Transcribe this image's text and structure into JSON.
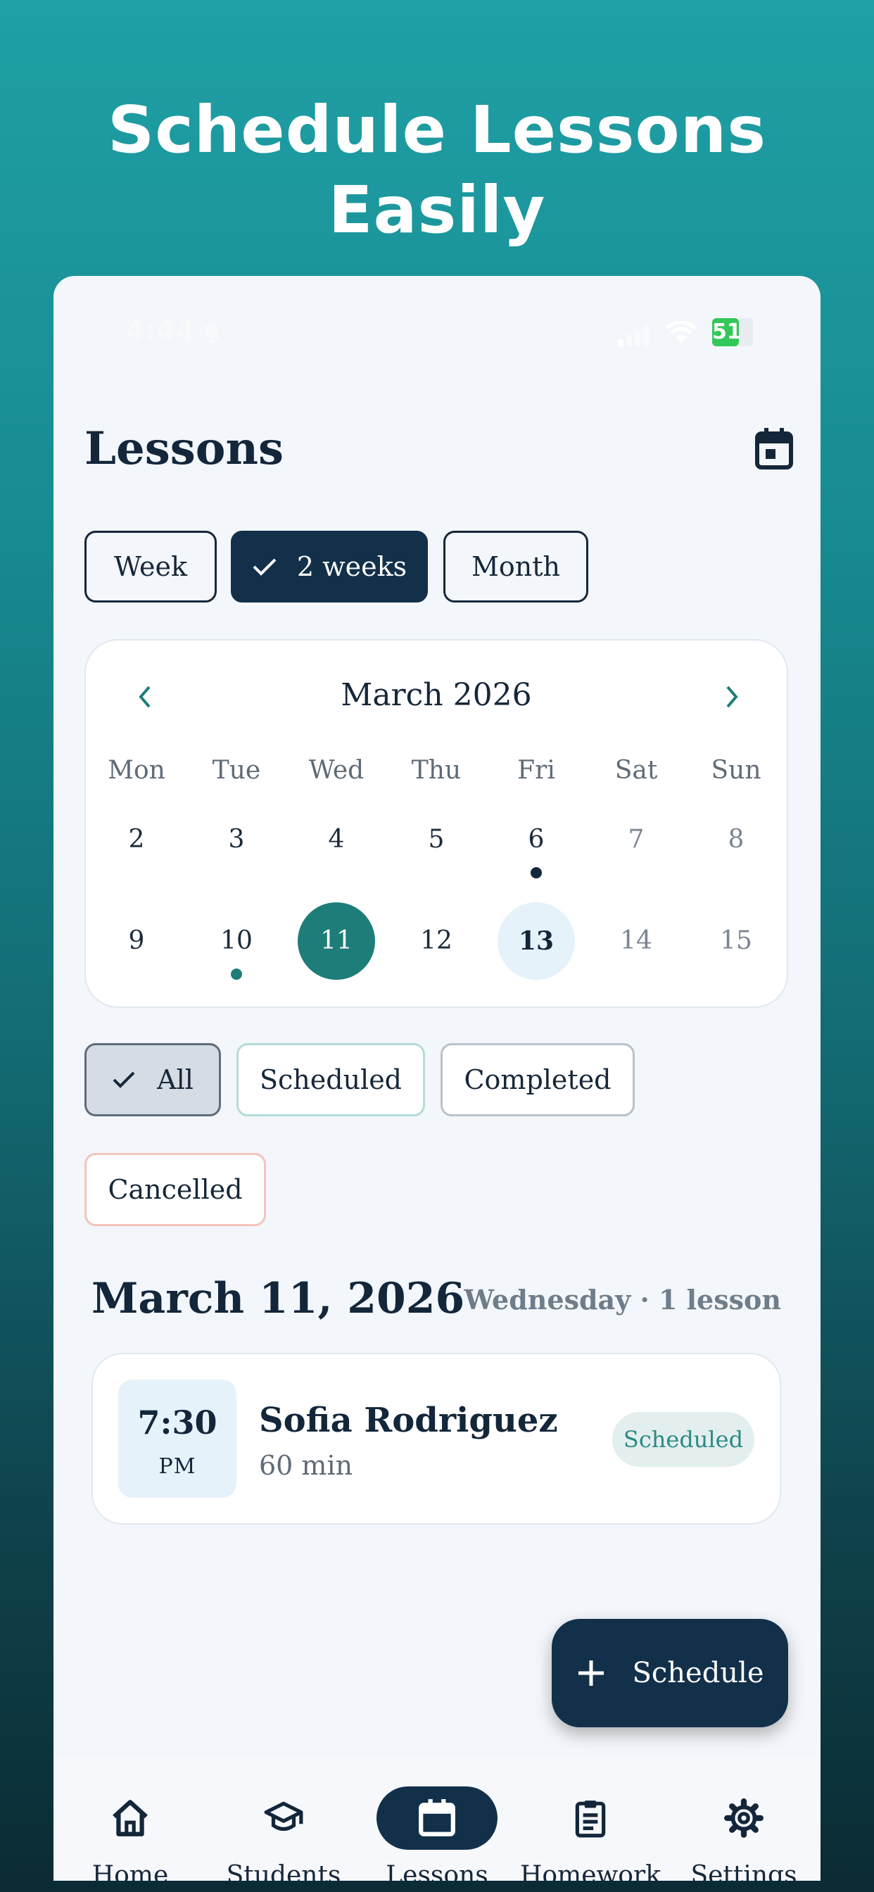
{
  "promo": {
    "line1": "Schedule Lessons",
    "line2": "Easily"
  },
  "status_bar": {
    "time": "4:44",
    "battery": "51"
  },
  "header": {
    "title": "Lessons"
  },
  "range_tabs": [
    {
      "label": "Week",
      "active": false
    },
    {
      "label": "2 weeks",
      "active": true
    },
    {
      "label": "Month",
      "active": false
    }
  ],
  "calendar": {
    "month_label": "March 2026",
    "weekdays": [
      "Mon",
      "Tue",
      "Wed",
      "Thu",
      "Fri",
      "Sat",
      "Sun"
    ],
    "weeks": [
      [
        "2",
        "3",
        "4",
        "5",
        "6",
        "7",
        "8"
      ],
      [
        "9",
        "10",
        "11",
        "12",
        "13",
        "14",
        "15"
      ]
    ],
    "selected_day": "11",
    "today": "13",
    "dots": [
      {
        "day": "6",
        "color": "#13263a"
      },
      {
        "day": "10",
        "color": "#1e7d78"
      }
    ]
  },
  "filters": [
    {
      "label": "All",
      "active": true,
      "border": "#5e6c79",
      "bg": "#d5dce3"
    },
    {
      "label": "Scheduled",
      "active": false,
      "border": "#b4dcd8",
      "bg": "#ffffff"
    },
    {
      "label": "Completed",
      "active": false,
      "border": "#b9c2ca",
      "bg": "#ffffff"
    },
    {
      "label": "Cancelled",
      "active": false,
      "border": "#f2c4bc",
      "bg": "#ffffff"
    }
  ],
  "day_section": {
    "date": "March 11, 2026",
    "meta": "Wednesday · 1 lesson"
  },
  "lessons": [
    {
      "time": "7:30",
      "ampm": "PM",
      "student": "Sofia Rodriguez",
      "duration": "60 min",
      "status": "Scheduled"
    }
  ],
  "fab": {
    "label": "Schedule"
  },
  "nav": [
    {
      "label": "Home",
      "icon": "home-icon",
      "active": false
    },
    {
      "label": "Students",
      "icon": "graduation-cap-icon",
      "active": false
    },
    {
      "label": "Lessons",
      "icon": "calendar-icon",
      "active": true
    },
    {
      "label": "Homework",
      "icon": "clipboard-icon",
      "active": false
    },
    {
      "label": "Settings",
      "icon": "gear-icon",
      "active": false
    }
  ]
}
